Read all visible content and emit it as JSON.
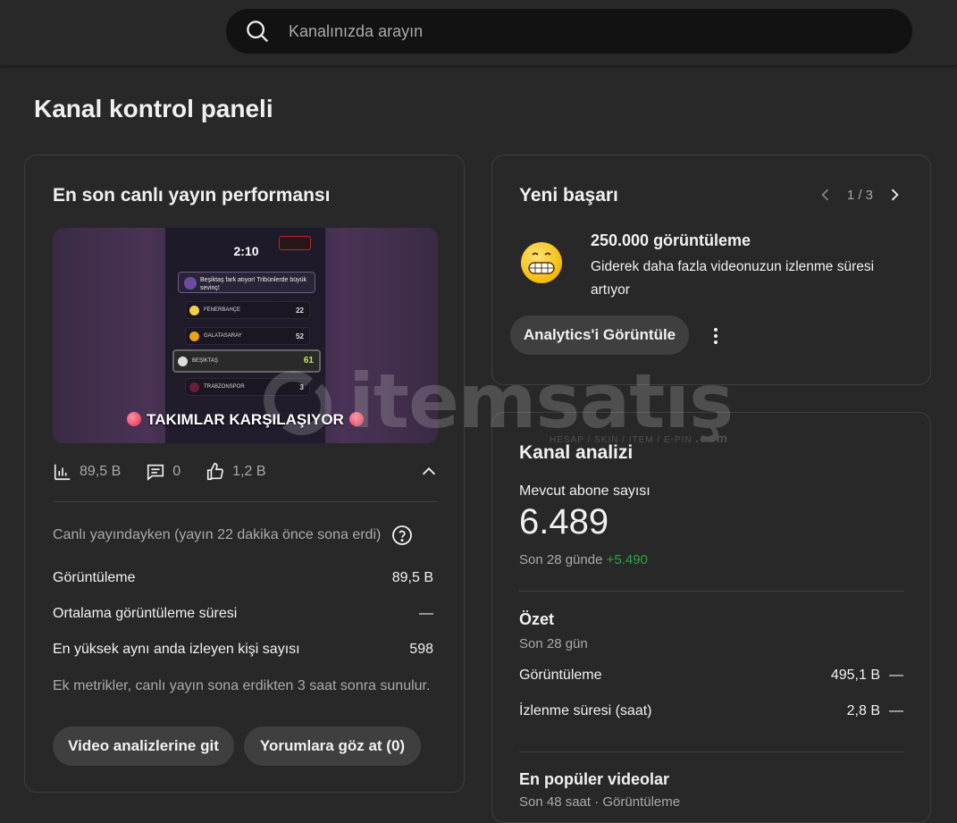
{
  "search": {
    "placeholder": "Kanalınızda arayın"
  },
  "page_title": "Kanal kontrol paneli",
  "live_card": {
    "title": "En son canlı yayın performansı",
    "thumbnail": {
      "timer": "2:10",
      "message": "Beşiktaş fark atıyor! Tribünlerde büyük sevinç!",
      "rows": [
        {
          "team": "FENERBAHÇE",
          "score": "22",
          "color": "#f4d03f"
        },
        {
          "team": "GALATASARAY",
          "score": "52",
          "color": "#e8a317"
        },
        {
          "team": "BEŞİKTAŞ",
          "score": "61",
          "color": "#dddddd"
        },
        {
          "team": "TRABZONSPOR",
          "score": "3",
          "color": "#6a1e3a"
        }
      ],
      "caption": "TAKIMLAR KARŞILAŞIYOR"
    },
    "stats": {
      "views": "89,5 B",
      "comments": "0",
      "likes": "1,2 B"
    },
    "live_note": "Canlı yayındayken (yayın 22 dakika önce sona erdi)",
    "metrics": [
      {
        "label": "Görüntüleme",
        "value": "89,5 B"
      },
      {
        "label": "Ortalama görüntüleme süresi",
        "value": "—"
      },
      {
        "label": "En yüksek aynı anda izleyen kişi sayısı",
        "value": "598"
      }
    ],
    "extra_note": "Ek metrikler, canlı yayın sona erdikten 3 saat sonra sunulur.",
    "btn_video": "Video analizlerine git",
    "btn_comments": "Yorumlara göz at (0)"
  },
  "achievement_card": {
    "title": "Yeni başarı",
    "pager": "1 / 3",
    "headline": "250.000 görüntüleme",
    "description": "Giderek daha fazla videonuzun izlenme süresi artıyor",
    "btn_analytics": "Analytics'i Görüntüle"
  },
  "analytics_card": {
    "title": "Kanal analizi",
    "subs_label": "Mevcut abone sayısı",
    "subs_value": "6.489",
    "subs_period": "Son 28 günde",
    "subs_delta": "+5.490",
    "summary_title": "Özet",
    "summary_sub": "Son 28 gün",
    "summary": [
      {
        "label": "Görüntüleme",
        "value": "495,1 B",
        "trend": "—"
      },
      {
        "label": "İzlenme süresi (saat)",
        "value": "2,8 B",
        "trend": "—"
      }
    ],
    "popular_title": "En popüler videolar",
    "popular_sub": "Son 48 saat · Görüntüleme"
  },
  "watermark": {
    "text": "itemsatış",
    "tag": "HESAP / SKIN / ITEM / E-PIN",
    "domain": ".com"
  }
}
